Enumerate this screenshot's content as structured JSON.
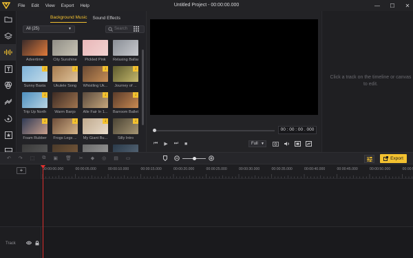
{
  "app": {
    "title": "Untitled Project - 00:00:00.000",
    "menu": [
      "File",
      "Edit",
      "View",
      "Export",
      "Help"
    ],
    "accent": "#f3c130"
  },
  "media": {
    "tabs": [
      "Background Music",
      "Sound Effects"
    ],
    "active_tab": "Background Music",
    "filter": "All (25)",
    "search_placeholder": "Search",
    "items": [
      {
        "label": "Advertime",
        "dl": false,
        "colors": [
          "#3a2b2a",
          "#e07b3b"
        ]
      },
      {
        "label": "City Sunshine",
        "dl": false,
        "colors": [
          "#8f8d86",
          "#c9c4b4"
        ]
      },
      {
        "label": "Pickled Pink",
        "dl": false,
        "colors": [
          "#e9b7b8",
          "#f2d3d2"
        ]
      },
      {
        "label": "Relaxing Ballad",
        "dl": false,
        "colors": [
          "#8a8e96",
          "#c7c9cd"
        ]
      },
      {
        "label": "Sunny Basta",
        "dl": true,
        "colors": [
          "#7cb1d8",
          "#c3dbe8"
        ]
      },
      {
        "label": "Ukulele Song",
        "dl": true,
        "colors": [
          "#a57b4e",
          "#e0c39b"
        ]
      },
      {
        "label": "Whistling Uk...",
        "dl": true,
        "colors": [
          "#6a4a33",
          "#c78e56"
        ]
      },
      {
        "label": "Journey of ...",
        "dl": true,
        "colors": [
          "#5d5a2e",
          "#c5b86c"
        ]
      },
      {
        "label": "Trip Up North",
        "dl": true,
        "colors": [
          "#4d8fbf",
          "#b8d4e3"
        ]
      },
      {
        "label": "Warm Banjo",
        "dl": false,
        "colors": [
          "#3c2a23",
          "#a0744f"
        ]
      },
      {
        "label": "Alle Fair In 1...",
        "dl": true,
        "colors": [
          "#5b4a3d",
          "#c6a77c"
        ]
      },
      {
        "label": "Barroom Ballet",
        "dl": true,
        "colors": [
          "#5a3b2a",
          "#c88a52"
        ]
      },
      {
        "label": "Foam Rubber",
        "dl": true,
        "colors": [
          "#2f3a55",
          "#caa08c"
        ]
      },
      {
        "label": "Frogs Legs ...",
        "dl": true,
        "colors": [
          "#6e4e3a",
          "#d6b58a"
        ]
      },
      {
        "label": "My Giant Bu...",
        "dl": true,
        "colors": [
          "#bfa98d",
          "#e9dccb"
        ]
      },
      {
        "label": "Silly Intro",
        "dl": true,
        "colors": [
          "#4a4334",
          "#a79674"
        ]
      },
      {
        "label": "",
        "dl": false,
        "colors": [
          "#3a3a3a",
          "#5a5a5a"
        ]
      },
      {
        "label": "",
        "dl": false,
        "colors": [
          "#4a3a2a",
          "#7a5a3a"
        ]
      },
      {
        "label": "",
        "dl": false,
        "colors": [
          "#6a6a6a",
          "#9a9a9a"
        ]
      },
      {
        "label": "",
        "dl": false,
        "colors": [
          "#2a3a4a",
          "#5a6a7a"
        ]
      }
    ]
  },
  "preview": {
    "timecode": "00 : 00 : 00 . 000",
    "quality": "Full",
    "progress": 0.0
  },
  "props": {
    "hint": "Click a track on the timeline or canvas to edit."
  },
  "toolbar": {
    "export_label": "Export"
  },
  "timeline": {
    "ruler": [
      "00:00:00.000",
      "00:00:05.000",
      "00:00:10.000",
      "00:00:15.000",
      "00:00:20.000",
      "00:00:25.000",
      "00:00:30.000",
      "00:00:35.000",
      "00:00:40.000",
      "00:00:45.000",
      "00:00:50.000",
      "00:00:55"
    ],
    "track_label": "Track"
  }
}
